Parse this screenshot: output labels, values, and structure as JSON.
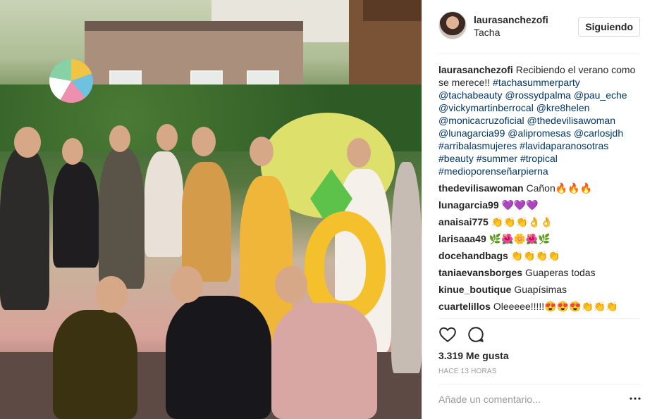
{
  "post": {
    "username": "laurasanchezofi",
    "location": "Tacha",
    "follow_label": "Siguiendo",
    "caption": {
      "text": "Recibiendo el verano como se merece!!",
      "tags": [
        "#tachasummerparty",
        "@tachabeauty",
        "@rossydpalma",
        "@pau_eche",
        "@vickymartinberrocal",
        "@kre8helen",
        "@monicacruzoficial",
        "@thedevilisawoman",
        "@lunagarcia99",
        "@alipromesas",
        "@carlosjdh",
        "#arribalasmujeres",
        "#lavidaparanosotras",
        "#beauty",
        "#summer",
        "#tropical",
        "#medioporenseñarpierna"
      ]
    },
    "comments": [
      {
        "user": "thedevilisawoman",
        "text": "Cañon🔥🔥🔥"
      },
      {
        "user": "lunagarcia99",
        "text": "💜💜💜"
      },
      {
        "user": "anaisai775",
        "text": "👏👏👏👌👌"
      },
      {
        "user": "larisaaa49",
        "text": "🌿🌺🌼🌺🌿"
      },
      {
        "user": "docehandbags",
        "text": "👏👏👏👏"
      },
      {
        "user": "taniaevansborges",
        "text": "Guaperas todas"
      },
      {
        "user": "kinue_boutique",
        "text": "Guapísimas"
      },
      {
        "user": "cuartelillos",
        "text": "Oleeeee!!!!!😍😍😍👏👏👏"
      }
    ],
    "likes": "3.319 Me gusta",
    "timestamp": "HACE 13 HORAS",
    "add_comment_placeholder": "Añade un comentario...",
    "icons": {
      "like": "heart-icon",
      "comment": "chat-icon",
      "more": "more-icon"
    }
  }
}
